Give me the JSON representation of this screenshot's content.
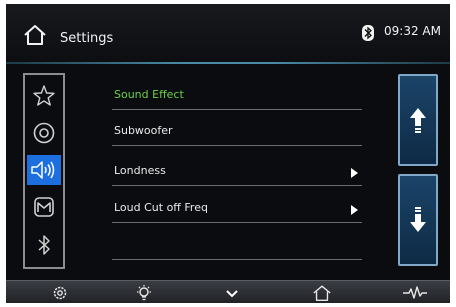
{
  "header": {
    "title": "Settings",
    "time": "09:32 AM",
    "icons": [
      "home-icon",
      "bluetooth-icon"
    ]
  },
  "sidebar": {
    "items": [
      {
        "icon": "star-icon",
        "active": false
      },
      {
        "icon": "disc-icon",
        "active": false
      },
      {
        "icon": "speaker-icon",
        "active": true
      },
      {
        "icon": "navigation-icon",
        "active": false
      },
      {
        "icon": "bluetooth-icon",
        "active": false
      }
    ]
  },
  "menu": {
    "items": [
      {
        "label": "Sound Effect",
        "highlighted": true,
        "has_arrow": false
      },
      {
        "label": "Subwoofer",
        "highlighted": false,
        "has_arrow": false
      },
      {
        "label": "Londness",
        "highlighted": false,
        "has_arrow": true
      },
      {
        "label": "Loud Cut off Freq",
        "highlighted": false,
        "has_arrow": true
      }
    ]
  },
  "scroll": {
    "up_icon": "arrow-up-icon",
    "down_icon": "arrow-down-icon"
  },
  "bottombar": {
    "icons": [
      "gear-icon",
      "brightness-icon",
      "chevron-down-icon",
      "home-icon",
      "waveform-icon"
    ]
  },
  "colors": {
    "accent_blue": "#1d6fe0",
    "highlight_green": "#6bd04a"
  }
}
